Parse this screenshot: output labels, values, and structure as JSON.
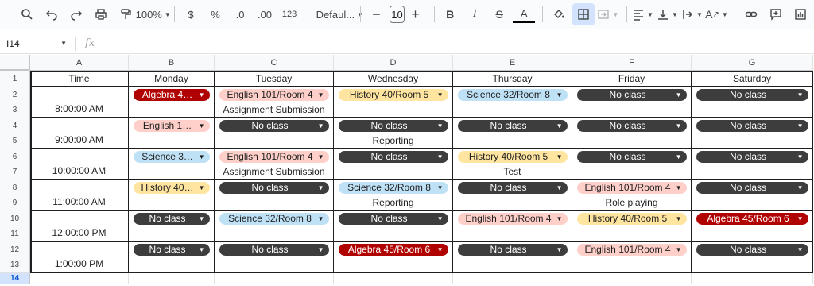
{
  "toolbar": {
    "zoom": "100%",
    "currency": "$",
    "percent": "%",
    "dec_decrease": ".0",
    "dec_increase": ".00",
    "number_format": "123",
    "font_name": "Defaul...",
    "font_size": "10",
    "bold": "B",
    "italic": "I",
    "strike": "S",
    "text_color": "A"
  },
  "formula_bar": {
    "cell_ref": "I14",
    "fx": "fx"
  },
  "columns": [
    "A",
    "B",
    "C",
    "D",
    "E",
    "F",
    "G"
  ],
  "rows": [
    "1",
    "2",
    "3",
    "4",
    "5",
    "6",
    "7",
    "8",
    "9",
    "10",
    "11",
    "12",
    "13",
    "14"
  ],
  "selected_row": "14",
  "sheet": {
    "header": [
      "Time",
      "Monday",
      "Tuesday",
      "Wednesday",
      "Thursday",
      "Friday",
      "Saturday"
    ],
    "times": [
      "8:00:00 AM",
      "9:00:00 AM",
      "10:00:00 AM",
      "11:00:00 AM",
      "12:00:00 PM",
      "1:00:00 PM"
    ],
    "chips": [
      [
        "Algebra 4…",
        "English 101/Room 4",
        "History 40/Room 5",
        "Science 32/Room 8",
        "No class",
        "No class"
      ],
      [
        "English 1…",
        "No class",
        "No class",
        "No class",
        "No class",
        "No class"
      ],
      [
        "Science 3…",
        "English 101/Room 4",
        "No class",
        "History 40/Room 5",
        "No class",
        "No class"
      ],
      [
        "History 40…",
        "No class",
        "Science 32/Room 8",
        "No class",
        "English 101/Room 4",
        "No class"
      ],
      [
        "No class",
        "Science 32/Room 8",
        "No class",
        "English 101/Room 4",
        "History 40/Room 5",
        "Algebra 45/Room 6"
      ],
      [
        "No class",
        "No class",
        "Algebra 45/Room 6",
        "No class",
        "English 101/Room 4",
        "No class"
      ]
    ],
    "notes": [
      [
        "",
        "Assignment Submission",
        "",
        "",
        "",
        ""
      ],
      [
        "",
        "",
        "Reporting",
        "",
        "",
        ""
      ],
      [
        "",
        "Assignment Submission",
        "",
        "Test",
        "",
        ""
      ],
      [
        "",
        "",
        "Reporting",
        "",
        "Role playing",
        ""
      ],
      [
        "",
        "",
        "",
        "",
        "",
        ""
      ],
      [
        "",
        "",
        "",
        "",
        "",
        ""
      ]
    ]
  },
  "chip_colors": {
    "algebra": "#b10202",
    "english": "#ffcfc9",
    "history": "#ffe5a0",
    "science": "#bfe1f6",
    "noclass": "#3d3d3d"
  }
}
